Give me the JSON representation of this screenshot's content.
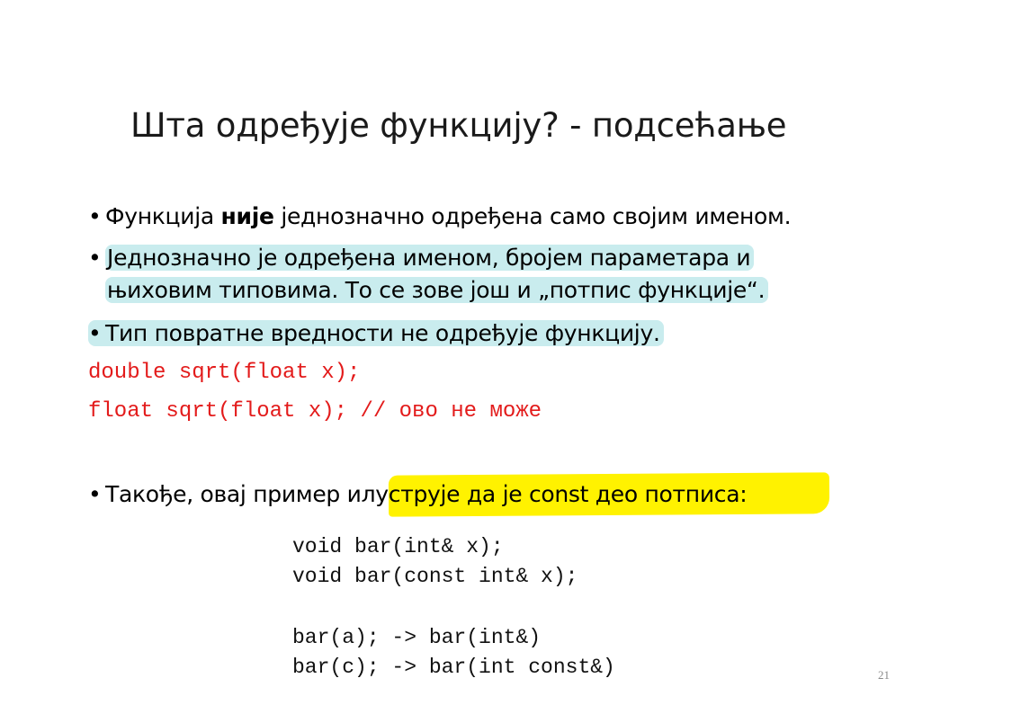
{
  "title": "Шта одређује функцију? - подсећање",
  "bullets": {
    "b1": {
      "before": "Функција ",
      "bold": "није",
      "after": " једнозначно одређена само својим именом."
    },
    "b2": {
      "line1": "Једнозначно је одређена именом, бројем параметара и",
      "line2": "њиховим типовима. То се зове још и „потпис функције“."
    },
    "b3": {
      "text": "Тип повратне вредности не одређује функцију."
    },
    "b4": {
      "text": "Такође, овај пример илуструје да је const део потписа:"
    }
  },
  "code_red": {
    "line1": "double sqrt(float x);",
    "line2": "float sqrt(float x); // ово не може"
  },
  "code_example": [
    "void bar(int& x);",
    "void bar(const int& x);",
    "",
    "bar(a); -> bar(int&)",
    "bar(c); -> bar(int const&)"
  ],
  "page_number": "21",
  "colors": {
    "highlight_cyan": "#c9ecee",
    "highlight_yellow": "#fff200",
    "code_red": "#e31b1b"
  }
}
